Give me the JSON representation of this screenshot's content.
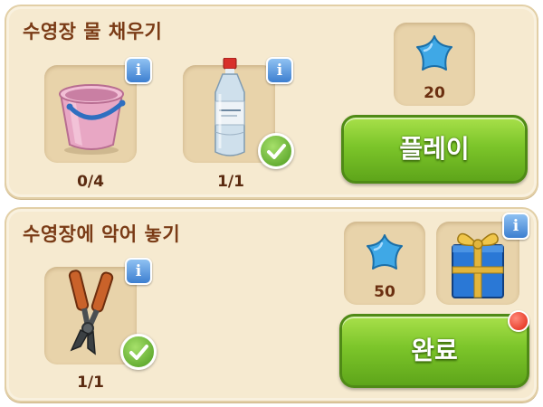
{
  "tasks": [
    {
      "title": "수영장 물 채우기",
      "items": [
        {
          "icon": "bucket-icon",
          "progress": "0/4",
          "done": false
        },
        {
          "icon": "water-bottle-icon",
          "progress": "1/1",
          "done": true
        }
      ],
      "reward": {
        "icon": "blue-star-icon",
        "value": "20"
      },
      "button_label": "플레이"
    },
    {
      "title": "수영장에 악어 놓기",
      "items": [
        {
          "icon": "bolt-cutter-icon",
          "progress": "1/1",
          "done": true
        }
      ],
      "reward": {
        "icon": "blue-star-icon",
        "value": "50"
      },
      "bonus_reward": {
        "icon": "gift-box-icon"
      },
      "button_label": "완료",
      "notification": true
    }
  ],
  "info_label": "i",
  "colors": {
    "panel": "#f6ead0",
    "title": "#7a3b16",
    "button_green": "#7cc52a",
    "info_blue": "#3d7fd0",
    "star_blue": "#3fa8e6"
  }
}
